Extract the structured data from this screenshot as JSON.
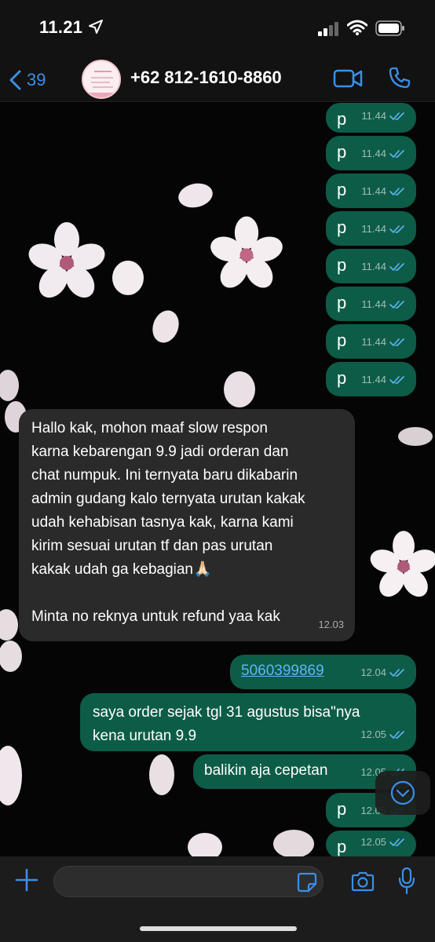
{
  "status": {
    "time": "11.21"
  },
  "header": {
    "back_count": "39",
    "contact": "+62 812-1610-8860"
  },
  "messages": [
    {
      "dir": "out",
      "text": "p",
      "time": "11.44"
    },
    {
      "dir": "out",
      "text": "p",
      "time": "11.44"
    },
    {
      "dir": "out",
      "text": "p",
      "time": "11.44"
    },
    {
      "dir": "out",
      "text": "p",
      "time": "11.44"
    },
    {
      "dir": "out",
      "text": "p",
      "time": "11.44"
    },
    {
      "dir": "out",
      "text": "p",
      "time": "11.44"
    },
    {
      "dir": "out",
      "text": "p",
      "time": "11.44"
    },
    {
      "dir": "out",
      "text": "p",
      "time": "11.44"
    },
    {
      "dir": "in",
      "lines": [
        "Hallo kak, mohon maaf slow respon",
        "karna kebarengan 9.9 jadi orderan dan",
        "chat numpuk. Ini ternyata baru dikabarin",
        "admin gudang kalo ternyata urutan kakak",
        "udah kehabisan tasnya kak, karna kami",
        "kirim sesuai urutan tf dan pas urutan",
        "kakak udah ga kebagian🙏🏻",
        "",
        "Minta no reknya untuk refund yaa kak"
      ],
      "time": "12.03"
    },
    {
      "dir": "out",
      "text": "5060399869",
      "time": "12.04",
      "link": true
    },
    {
      "dir": "out",
      "lines": [
        "saya order sejak tgl 31 agustus bisa\"nya",
        "kena urutan 9.9"
      ],
      "time": "12.05"
    },
    {
      "dir": "out",
      "text": "balikin aja cepetan",
      "time": "12.05"
    },
    {
      "dir": "out",
      "text": "p",
      "time": "12.05"
    },
    {
      "dir": "out",
      "text": "p",
      "time": "12.05"
    }
  ],
  "icons": {
    "back": "chevron-left-icon",
    "video": "video-camera-icon",
    "phone": "phone-icon",
    "plus": "plus-icon",
    "sticker": "sticker-icon",
    "camera": "camera-icon",
    "mic": "microphone-icon",
    "scroll": "chevron-down-circle-icon",
    "ticks": "double-check-icon"
  },
  "colors": {
    "accent": "#3b8fe8",
    "outgoing": "#0d5c48",
    "incoming": "#2a2a2a",
    "read_ticks": "#5fb5f5"
  }
}
